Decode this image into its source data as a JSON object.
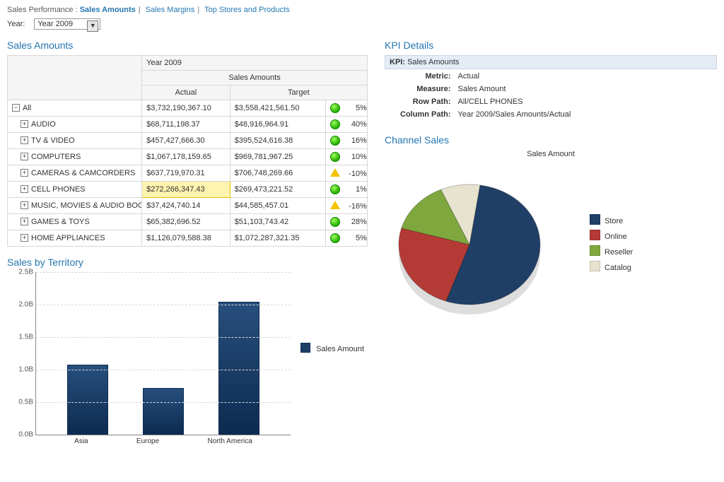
{
  "breadcrumb": {
    "prefix": "Sales Performance :",
    "items": [
      "Sales Amounts",
      "Sales Margins",
      "Top Stores and Products"
    ],
    "active_index": 0
  },
  "year": {
    "label": "Year:",
    "value": "Year 2009"
  },
  "table": {
    "title": "Sales Amounts",
    "year_header": "Year 2009",
    "metric_header": "Sales Amounts",
    "col_actual": "Actual",
    "col_target": "Target",
    "rows": [
      {
        "label": "All",
        "level": 0,
        "exp": "−",
        "actual": "$3,732,190,367.10",
        "target": "$3,558,421,561.50",
        "status": "green",
        "var": "5%",
        "highlight": false
      },
      {
        "label": "AUDIO",
        "level": 1,
        "exp": "+",
        "actual": "$68,711,198.37",
        "target": "$48,916,964.91",
        "status": "green",
        "var": "40%",
        "highlight": false
      },
      {
        "label": "TV & VIDEO",
        "level": 1,
        "exp": "+",
        "actual": "$457,427,666.30",
        "target": "$395,524,616.38",
        "status": "green",
        "var": "16%",
        "highlight": false
      },
      {
        "label": "COMPUTERS",
        "level": 1,
        "exp": "+",
        "actual": "$1,067,178,159.65",
        "target": "$969,781,967.25",
        "status": "green",
        "var": "10%",
        "highlight": false
      },
      {
        "label": "CAMERAS & CAMCORDERS",
        "level": 1,
        "exp": "+",
        "actual": "$637,719,970.31",
        "target": "$706,748,269.66",
        "status": "yellow",
        "var": "-10%",
        "highlight": false
      },
      {
        "label": "CELL PHONES",
        "level": 1,
        "exp": "+",
        "actual": "$272,266,347.43",
        "target": "$269,473,221.52",
        "status": "green",
        "var": "1%",
        "highlight": true
      },
      {
        "label": "MUSIC, MOVIES & AUDIO BOOKS",
        "level": 1,
        "exp": "+",
        "actual": "$37,424,740.14",
        "target": "$44,585,457.01",
        "status": "yellow",
        "var": "-16%",
        "highlight": false
      },
      {
        "label": "GAMES & TOYS",
        "level": 1,
        "exp": "+",
        "actual": "$65,382,696.52",
        "target": "$51,103,743.42",
        "status": "green",
        "var": "28%",
        "highlight": false
      },
      {
        "label": "HOME APPLIANCES",
        "level": 1,
        "exp": "+",
        "actual": "$1,126,079,588.38",
        "target": "$1,072,287,321.35",
        "status": "green",
        "var": "5%",
        "highlight": false
      }
    ]
  },
  "kpi": {
    "title": "KPI Details",
    "header_label": "KPI:",
    "header_value": "Sales Amounts",
    "metric_label": "Metric:",
    "metric_value": "Actual",
    "measure_label": "Measure:",
    "measure_value": "Sales Amount",
    "rowpath_label": "Row Path:",
    "rowpath_value": "All/CELL PHONES",
    "colpath_label": "Column Path:",
    "colpath_value": "Year 2009/Sales Amounts/Actual"
  },
  "territory_title": "Sales by Territory",
  "channel_title": "Channel Sales",
  "chart_data": [
    {
      "type": "bar",
      "title": "Sales by Territory",
      "series_name": "Sales Amount",
      "categories": [
        "Asia",
        "Europe",
        "North America"
      ],
      "values": [
        1.05,
        0.7,
        2.02
      ],
      "y_ticks": [
        "0.0B",
        "0.5B",
        "1.0B",
        "1.5B",
        "2.0B",
        "2.5B"
      ],
      "ylim": [
        0,
        2.5
      ],
      "unit": "B"
    },
    {
      "type": "pie",
      "title": "Sales Amount",
      "series": [
        {
          "name": "Store",
          "value": 53,
          "color": "#1f3f66"
        },
        {
          "name": "Online",
          "value": 24,
          "color": "#b43a36"
        },
        {
          "name": "Reseller",
          "value": 14,
          "color": "#7ea83e"
        },
        {
          "name": "Catalog",
          "value": 9,
          "color": "#e8e3cf"
        }
      ]
    }
  ]
}
